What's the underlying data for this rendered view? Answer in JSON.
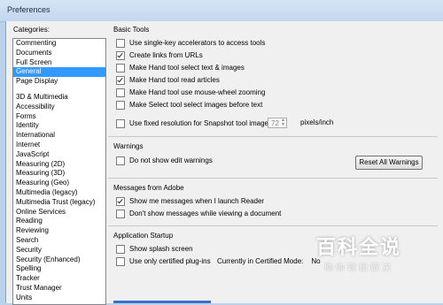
{
  "window": {
    "title": "Preferences"
  },
  "categories": {
    "label": "Categories:",
    "group1": [
      "Commenting",
      "Documents",
      "Full Screen",
      "General",
      "Page Display"
    ],
    "group2": [
      "3D & Multimedia",
      "Accessibility",
      "Forms",
      "Identity",
      "International",
      "Internet",
      "JavaScript",
      "Measuring (2D)",
      "Measuring (3D)",
      "Measuring (Geo)",
      "Multimedia (legacy)",
      "Multimedia Trust (legacy)",
      "Online Services",
      "Reading",
      "Reviewing",
      "Search",
      "Security",
      "Security (Enhanced)",
      "Spelling",
      "Tracker",
      "Trust Manager",
      "Units"
    ],
    "selected": "General"
  },
  "basic_tools": {
    "title": "Basic Tools",
    "options": [
      {
        "label": "Use single-key accelerators to access tools",
        "checked": false
      },
      {
        "label": "Create links from URLs",
        "checked": true
      },
      {
        "label": "Make Hand tool select text & images",
        "checked": false
      },
      {
        "label": "Make Hand tool read articles",
        "checked": true
      },
      {
        "label": "Make Hand tool use mouse-wheel zooming",
        "checked": false
      },
      {
        "label": "Make Select tool select images before text",
        "checked": false
      },
      {
        "label": "Use fixed resolution for Snapshot tool images:",
        "checked": false
      }
    ],
    "snapshot_value": "72",
    "snapshot_unit": "pixels/inch"
  },
  "warnings": {
    "title": "Warnings",
    "option": {
      "label": "Do not show edit warnings",
      "checked": false
    },
    "reset_button": "Reset All Warnings"
  },
  "messages": {
    "title": "Messages from Adobe",
    "options": [
      {
        "label": "Show me messages when I launch Reader",
        "checked": true
      },
      {
        "label": "Don't show messages while viewing a document",
        "checked": false
      }
    ]
  },
  "startup": {
    "title": "Application Startup",
    "options": [
      {
        "label": "Show splash screen",
        "checked": false
      },
      {
        "label": "Use only certified plug-ins",
        "checked": false
      }
    ],
    "certified_mode_label": "Currently in Certified Mode:",
    "certified_mode_value": "No"
  },
  "watermark": {
    "main": "百科全说",
    "sub": "助你轻松解决"
  }
}
